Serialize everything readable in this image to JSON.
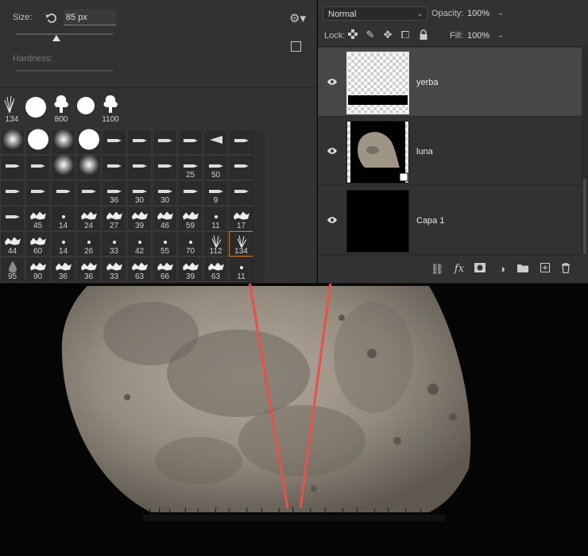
{
  "brush_panel": {
    "size_label": "Size:",
    "size_value": "85 px",
    "hardness_label": "Hardness:",
    "recent_brushes": [
      "134",
      "",
      "800",
      "",
      "1100"
    ],
    "grid": [
      [
        "",
        "",
        "",
        "",
        "",
        "",
        "",
        "",
        "",
        ""
      ],
      [
        "",
        "",
        "",
        "",
        "",
        "",
        "",
        "25",
        "50",
        ""
      ],
      [
        "",
        "",
        "",
        "",
        "36",
        "30",
        "30",
        "",
        "9",
        ""
      ],
      [
        "",
        "45",
        "14",
        "24",
        "27",
        "39",
        "46",
        "59",
        "11",
        "17"
      ],
      [
        "44",
        "60",
        "14",
        "26",
        "33",
        "42",
        "55",
        "70",
        "112",
        "134"
      ],
      [
        "95",
        "90",
        "36",
        "36",
        "33",
        "63",
        "66",
        "39",
        "63",
        "11"
      ]
    ],
    "selected_cell": "134"
  },
  "layers_panel": {
    "blend_mode": "Normal",
    "opacity_label": "Opacity:",
    "opacity_value": "100%",
    "lock_label": "Lock:",
    "fill_label": "Fill:",
    "fill_value": "100%",
    "layers": [
      {
        "name": "yerba",
        "visible": true,
        "active": true
      },
      {
        "name": "luna",
        "visible": true,
        "active": false
      },
      {
        "name": "Capa 1",
        "visible": true,
        "active": false
      }
    ]
  },
  "annotation": {
    "color": "#e8504a"
  },
  "icons": {
    "lock": [
      "checkerboard-lock-icon",
      "brush-lock-icon",
      "move-lock-icon",
      "artboard-lock-icon",
      "padlock-icon"
    ],
    "footer": [
      "link-icon",
      "fx-icon",
      "mask-icon",
      "adjustment-icon",
      "folder-icon",
      "new-layer-icon",
      "trash-icon"
    ]
  }
}
